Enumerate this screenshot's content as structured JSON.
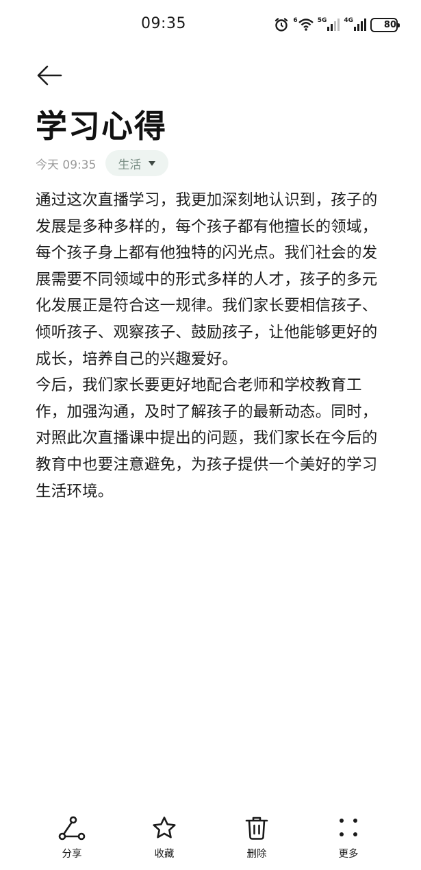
{
  "status_bar": {
    "time": "09:35",
    "network_label_1": "5G",
    "network_label_2": "4G",
    "wifi_label": "6",
    "battery_level": "80",
    "icons": [
      "alarm-icon",
      "wifi-icon",
      "signal-5g-icon",
      "signal-4g-icon",
      "battery-icon"
    ]
  },
  "header": {
    "back_icon": "arrow-left-icon",
    "title": "学习心得"
  },
  "meta": {
    "date": "今天 09:35",
    "category": "生活",
    "category_icon": "caret-down-icon"
  },
  "note": {
    "paragraphs": [
      "通过这次直播学习，我更加深刻地认识到，孩子的发展是多种多样的，每个孩子都有他擅长的领域，每个孩子身上都有他独特的闪光点。我们社会的发展需要不同领域中的形式多样的人才，孩子的多元化发展正是符合这一规律。我们家长要相信孩子、倾听孩子、观察孩子、鼓励孩子，让他能够更好的成长，培养自己的兴趣爱好。",
      "今后，我们家长要更好地配合老师和学校教育工作，加强沟通，及时了解孩子的最新动态。同时，对照此次直播课中提出的问题，我们家长在今后的教育中也要注意避免，为孩子提供一个美好的学习生活环境。"
    ]
  },
  "toolbar": {
    "share_label": "分享",
    "favorite_label": "收藏",
    "delete_label": "删除",
    "more_label": "更多",
    "icons": [
      "share-icon",
      "star-icon",
      "trash-icon",
      "more-dots-icon"
    ]
  }
}
